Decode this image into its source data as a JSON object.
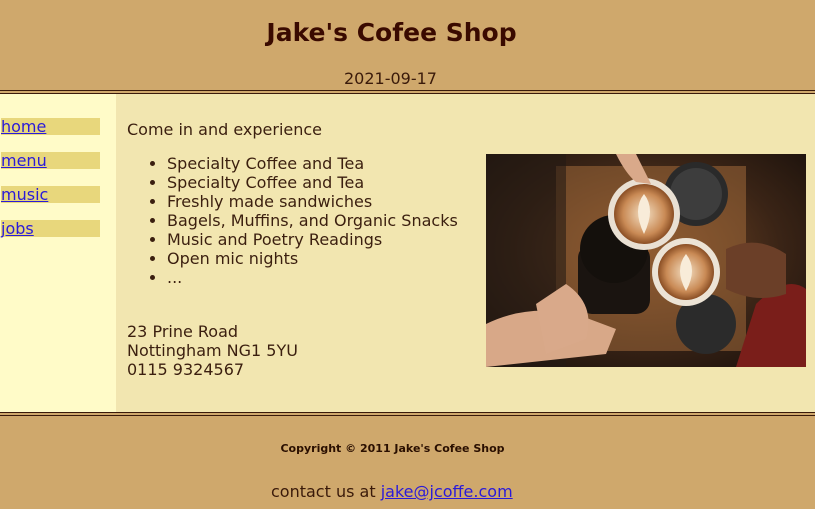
{
  "header": {
    "title": "Jake's Cofee Shop",
    "date": "2021-09-17"
  },
  "sidebar": {
    "items": [
      {
        "label": "home"
      },
      {
        "label": "menu"
      },
      {
        "label": "music"
      },
      {
        "label": "jobs"
      }
    ]
  },
  "main": {
    "intro": "Come in and experience",
    "features": [
      "Specialty Coffee and Tea",
      "Specialty Coffee and Tea",
      "Freshly made sandwiches",
      "Bagels, Muffins, and Organic Snacks",
      "Music and Poetry Readings",
      "Open mic nights",
      "..."
    ],
    "address": {
      "street": "23 Prine Road",
      "city": "Nottingham NG1 5YU",
      "phone": "0115 9324567"
    },
    "photo": {
      "icon": "coffee-cups-photo"
    }
  },
  "footer": {
    "copyright": "Copyright © 2011 Jake's Cofee Shop",
    "contact_prefix": "contact us at",
    "email": "jake@jcoffe.com"
  },
  "colors": {
    "header_bg": "#cfa86c",
    "sidebar_bg": "#fffbc8",
    "main_bg": "#f2e6b0",
    "nav_item_bg": "#e8d77c",
    "link": "#2a1ad9"
  }
}
